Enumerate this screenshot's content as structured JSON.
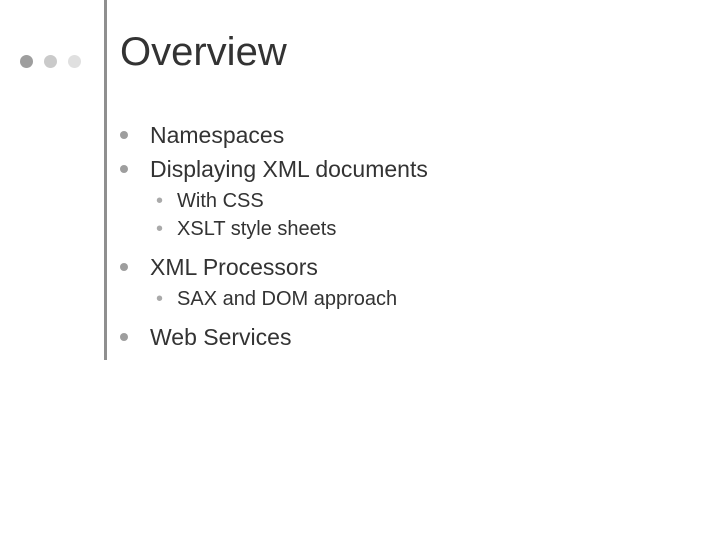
{
  "slide": {
    "title": "Overview",
    "items": [
      {
        "text": "Namespaces",
        "sub": []
      },
      {
        "text": "Displaying XML documents",
        "sub": [
          "With CSS",
          "XSLT style sheets"
        ]
      },
      {
        "text": "XML Processors",
        "sub": [
          "SAX and DOM approach"
        ]
      },
      {
        "text": "Web Services",
        "sub": []
      }
    ]
  }
}
